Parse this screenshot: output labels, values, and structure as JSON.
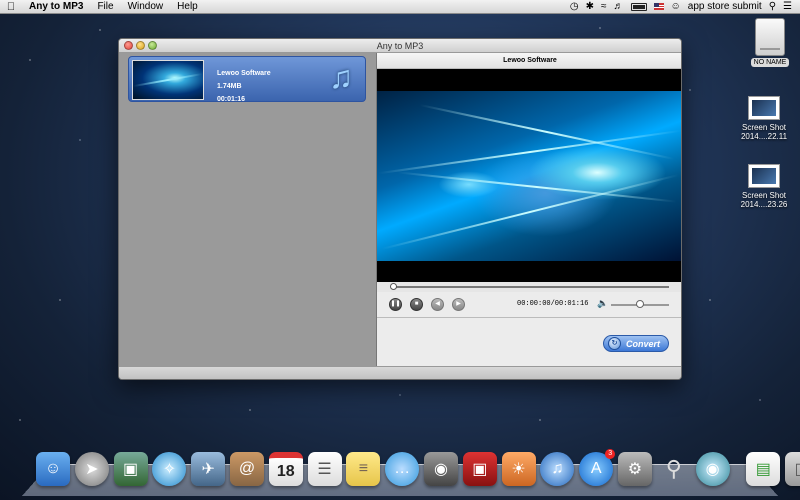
{
  "menubar": {
    "app_name": "Any to MP3",
    "items": [
      "File",
      "Window",
      "Help"
    ],
    "user": "app store submit"
  },
  "window": {
    "title": "Any to MP3"
  },
  "file_list": {
    "items": [
      {
        "name": "Lewoo Software",
        "size": "1.74MB",
        "duration": "00:01:16"
      }
    ]
  },
  "player": {
    "title": "Lewoo Software",
    "time": "00:00:00/00:01:16",
    "progress": 0.0,
    "volume": 0.5,
    "convert_label": "Convert"
  },
  "desktop": {
    "drive_label": "NO NAME",
    "screenshots": [
      {
        "line1": "Screen Shot",
        "line2": "2014....22.11"
      },
      {
        "line1": "Screen Shot",
        "line2": "2014....23.26"
      }
    ]
  },
  "dock": {
    "icons": [
      "finder-icon",
      "launchpad-icon",
      "photo-browser-icon",
      "safari-icon",
      "mail-icon",
      "contacts-icon",
      "calendar-icon",
      "reminders-icon",
      "notes-icon",
      "messages-icon",
      "facetime-icon",
      "photo-booth-icon",
      "iphoto-icon",
      "itunes-icon",
      "app-store-icon",
      "system-preferences-icon",
      "keychain-icon",
      "network-icon",
      "preview-icon",
      "trash-icon"
    ],
    "calendar_day": "18",
    "app_store_badge": "3"
  }
}
